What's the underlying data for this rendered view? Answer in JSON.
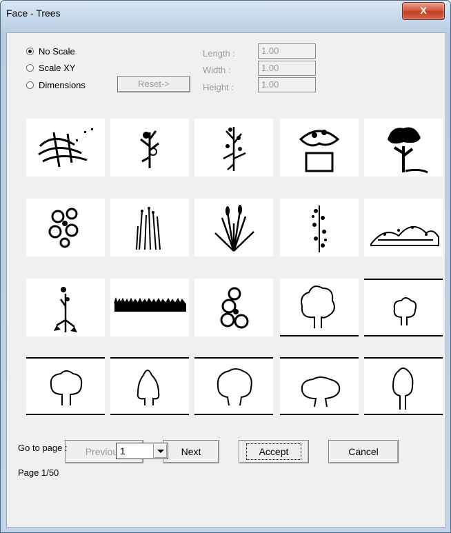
{
  "window": {
    "title": "Face - Trees",
    "close_glyph": "X"
  },
  "scale_options": [
    {
      "label": "No Scale",
      "checked": true
    },
    {
      "label": "Scale XY",
      "checked": false
    },
    {
      "label": "Dimensions",
      "checked": false
    }
  ],
  "reset_button": {
    "label": "Reset->",
    "enabled": false
  },
  "dimensions": {
    "length": {
      "label": "Length :",
      "value": "1.00"
    },
    "width": {
      "label": "Width :",
      "value": "1.00"
    },
    "height": {
      "label": "Height :",
      "value": "1.00"
    }
  },
  "tiles": [
    "plant-sketch-icon",
    "flower-stem-icon",
    "tall-flower-icon",
    "potted-plant-icon",
    "bush-tree-icon",
    "flower-cluster-icon",
    "reeds-icon",
    "grass-tuft-icon",
    "climbing-plant-icon",
    "hedge-icon",
    "single-flower-icon",
    "grass-strip-icon",
    "hydrangea-icon",
    "tree-outline-icon",
    "small-tree-icon",
    "round-tree-icon",
    "conical-tree-icon",
    "broad-tree-icon",
    "wide-tree-icon",
    "narrow-tree-icon"
  ],
  "buttons": {
    "previous": "Previous",
    "next": "Next",
    "accept": "Accept",
    "cancel": "Cancel"
  },
  "goto": {
    "label": "Go to page :",
    "selected": "1"
  },
  "status": {
    "page": "Page 1/50"
  }
}
